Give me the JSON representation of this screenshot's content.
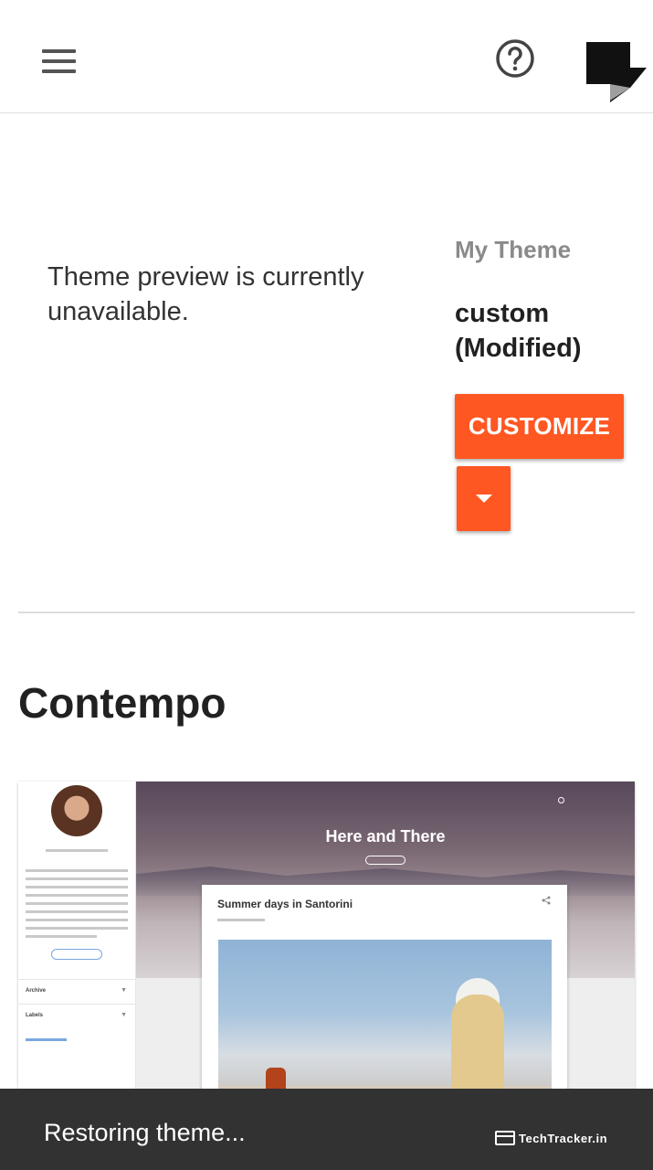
{
  "header": {
    "menu_icon": "hamburger-menu-icon",
    "help_icon": "help-circle-icon",
    "logo_icon": "blogger-logo-icon"
  },
  "theme_section": {
    "preview_message": "Theme preview is currently unavailable.",
    "my_theme_label": "My Theme",
    "theme_name": "custom (Modified)",
    "customize_label": "CUSTOMIZE",
    "dropdown_icon": "caret-down-icon",
    "accent_color": "#ff5722"
  },
  "gallery": {
    "theme_title": "Contempo",
    "thumbnail": {
      "blog_title": "Here and There",
      "post_title": "Summer days in Santorini",
      "sidebar_items": [
        {
          "label": "Archive"
        },
        {
          "label": "Labels"
        }
      ]
    }
  },
  "snackbar": {
    "message": "Restoring theme...",
    "background": "#323232"
  },
  "watermark": {
    "text": "TechTracker.in"
  }
}
